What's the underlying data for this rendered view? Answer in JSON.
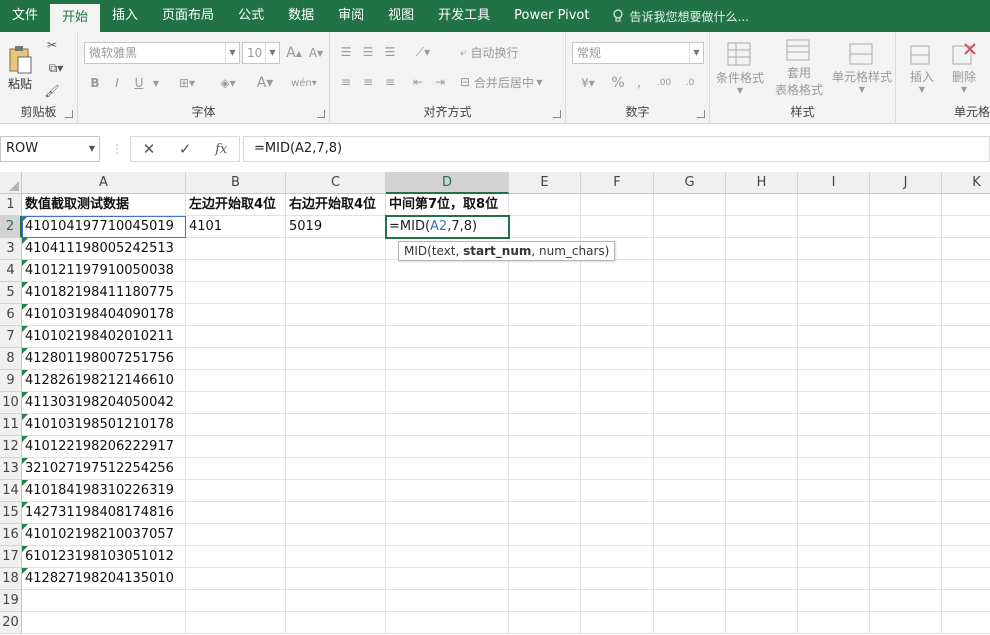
{
  "ribbon_tabs": [
    "文件",
    "开始",
    "插入",
    "页面布局",
    "公式",
    "数据",
    "审阅",
    "视图",
    "开发工具",
    "Power Pivot"
  ],
  "tell_me": "告诉我您想要做什么...",
  "groups": {
    "clipboard": {
      "label": "剪贴板",
      "paste": "粘贴"
    },
    "font": {
      "label": "字体",
      "font_name": "微软雅黑",
      "font_size": "10",
      "bold": "B",
      "italic": "I",
      "underline": "U"
    },
    "alignment": {
      "label": "对齐方式",
      "wrap": "自动换行",
      "merge": "合并后居中"
    },
    "number": {
      "label": "数字",
      "format": "常规",
      "percent": "%"
    },
    "styles": {
      "label": "样式",
      "conditional": "条件格式",
      "table_line1": "套用",
      "table_line2": "表格格式",
      "cell_styles": "单元格样式"
    },
    "cells": {
      "label": "单元格",
      "insert": "插入",
      "delete": "删除"
    }
  },
  "formula_bar": {
    "name_box": "ROW",
    "fx": "fx",
    "formula": "=MID(A2,7,8)"
  },
  "columns": [
    "A",
    "B",
    "C",
    "D",
    "E",
    "F",
    "G",
    "H",
    "I",
    "J",
    "K"
  ],
  "rows": [
    "1",
    "2",
    "3",
    "4",
    "5",
    "6",
    "7",
    "8",
    "9",
    "10",
    "11",
    "12",
    "13",
    "14",
    "15",
    "16",
    "17",
    "18",
    "19",
    "20"
  ],
  "headers": {
    "A1": "数值截取测试数据",
    "B1": "左边开始取4位",
    "C1": "右边开始取4位",
    "D1": "中间第7位，取8位"
  },
  "data_a": [
    "410104197710045019",
    "410411198005242513",
    "410121197910050038",
    "410182198411180775",
    "410103198404090178",
    "410102198402010211",
    "412801198007251756",
    "412826198212146610",
    "411303198204050042",
    "410103198501210178",
    "410122198206222917",
    "321027197512254256",
    "410184198310226319",
    "142731198408174816",
    "410102198210037057",
    "610123198103051012",
    "412827198204135010"
  ],
  "b2": "4101",
  "c2": "5019",
  "d2_parts": {
    "prefix": "=MID(",
    "ref": "A2",
    "suffix": ",7,8)"
  },
  "tooltip": {
    "pre": "MID(text, ",
    "bold": "start_num",
    "post": ", num_chars)"
  }
}
